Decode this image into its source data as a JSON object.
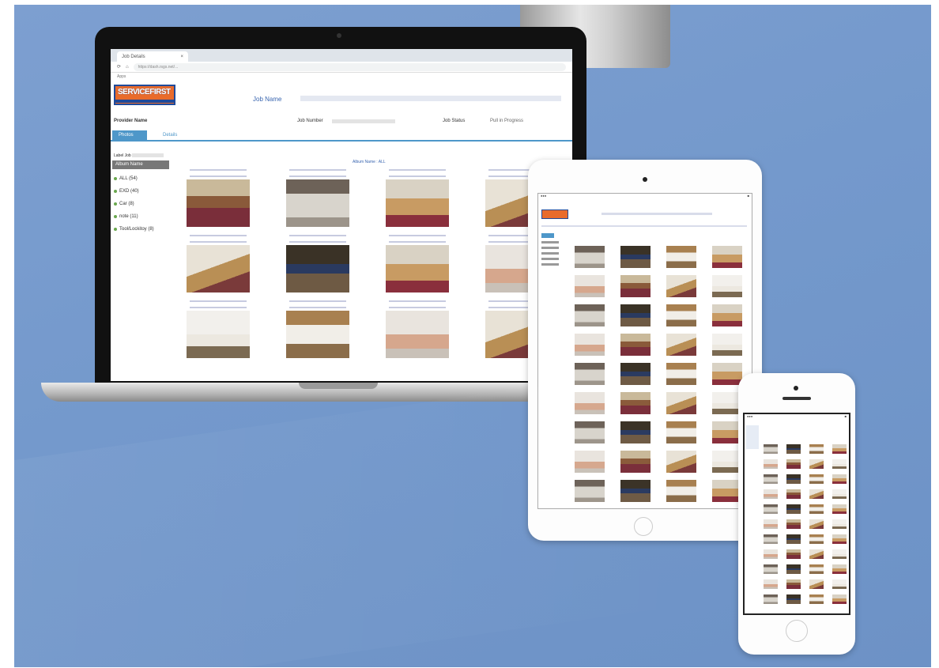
{
  "browser": {
    "tab_title": "Job Details",
    "tab_close": "×",
    "address": "https://dash.rsgs.net/...",
    "bookmark": "Apps"
  },
  "site": {
    "logo_text": "SERVICEFIRST",
    "job_name_label": "Job Name",
    "provider_label": "Provider Name",
    "job_number_label": "Job Number",
    "job_status_label": "Job Status",
    "job_status_value": "Pull in Progress",
    "tabs": [
      "Photos",
      "Details"
    ],
    "label_prefix": "Label Job",
    "album_header": "Album Name",
    "albums": [
      "ALL (54)",
      "EXD (40)",
      "Car (8)",
      "note (11)",
      "Tool/Lockitoy (8)"
    ],
    "photo_all_label": "Album Name : ALL"
  },
  "colors": {
    "accent": "#4e97c9",
    "logo_orange": "#e96b2b",
    "logo_blue": "#1f4a9a",
    "background": "#7499cc"
  },
  "laptop_photos": [
    {
      "tone": "room"
    },
    {
      "tone": "rug"
    },
    {
      "tone": "wood"
    },
    {
      "tone": "shelf"
    },
    {
      "tone": "shelf"
    },
    {
      "tone": "dark"
    },
    {
      "tone": "wood"
    },
    {
      "tone": "hand"
    },
    {
      "tone": "light"
    },
    {
      "tone": "box"
    },
    {
      "tone": "hand"
    },
    {
      "tone": "shelf"
    }
  ],
  "tablet_photo_count": 36,
  "phone_photo_count": 44
}
